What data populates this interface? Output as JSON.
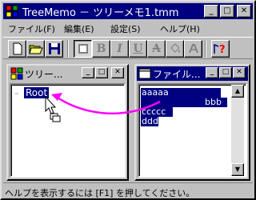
{
  "window": {
    "title": "TreeMemo － ツリーメモ1.tmm"
  },
  "menu": [
    "ファイル(F)",
    "編集(E)",
    "設定(S)",
    "ヘルプ(H)"
  ],
  "toolbar": {
    "bold": "B",
    "italic": "I",
    "underline": "U",
    "strike": "A",
    "help": "?"
  },
  "tree_window": {
    "title": "ツリー...",
    "root_label": "Root"
  },
  "file_window": {
    "title": "ファイル...",
    "lines": [
      "aaaaa",
      "bbb",
      "ccccc",
      "ddd"
    ]
  },
  "status": {
    "text": "ヘルプを表示するには [F1] を押してください。"
  },
  "colors": {
    "titlebar": "#000080",
    "face": "#c0c0c0",
    "arrow": "#ff00ff"
  }
}
